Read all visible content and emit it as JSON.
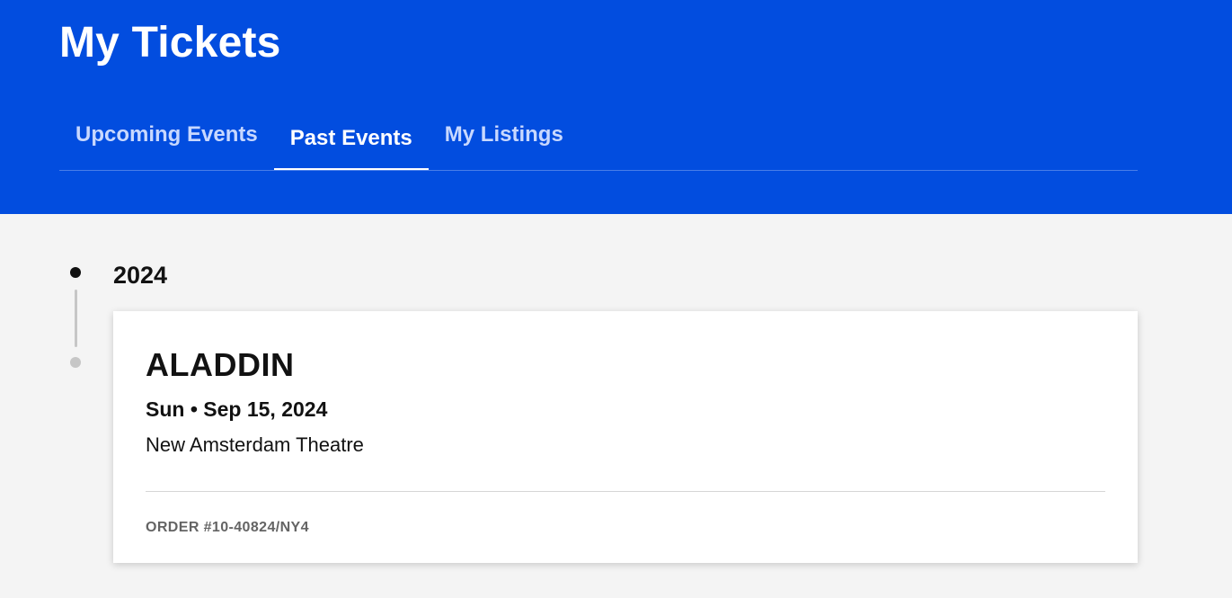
{
  "header": {
    "title": "My Tickets",
    "background_color": "#024ddf",
    "tabs": [
      {
        "label": "Upcoming Events",
        "active": false
      },
      {
        "label": "Past Events",
        "active": true
      },
      {
        "label": "My Listings",
        "active": false
      }
    ]
  },
  "timeline": {
    "groups": [
      {
        "year": "2024",
        "events": [
          {
            "name": "ALADDIN",
            "date": "Sun • Sep 15, 2024",
            "venue": "New Amsterdam Theatre",
            "order": "ORDER #10-40824/NY4"
          }
        ]
      }
    ]
  }
}
